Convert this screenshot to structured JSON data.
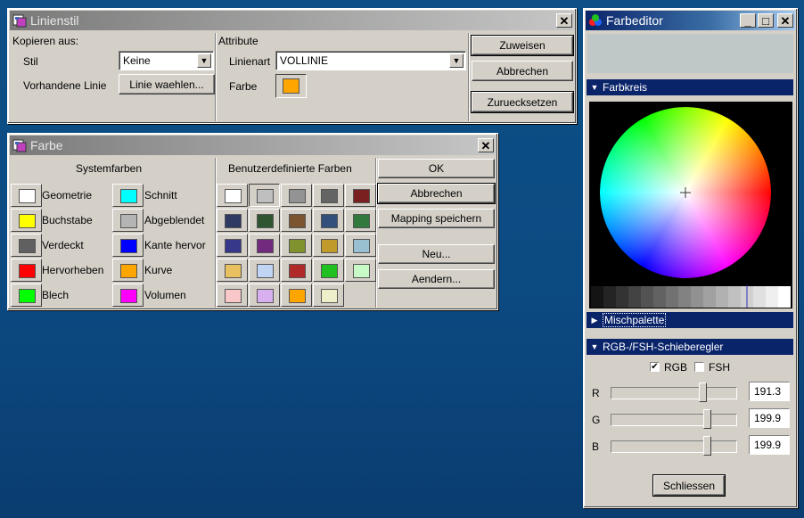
{
  "linienstil": {
    "title": "Linienstil",
    "kopieren_aus": "Kopieren aus:",
    "stil_label": "Stil",
    "stil_value": "Keine",
    "vorhandene_linie_label": "Vorhandene Linie",
    "linie_waehlen": "Linie waehlen...",
    "attribute": "Attribute",
    "linienart_label": "Linienart",
    "linienart_value": "VOLLINIE",
    "farbe_label": "Farbe",
    "farbe_color": "#ffa500",
    "zuweisen": "Zuweisen",
    "abbrechen": "Abbrechen",
    "zuruecksetzen": "Zuruecksetzen"
  },
  "farbe": {
    "title": "Farbe",
    "systemfarben": "Systemfarben",
    "benutzer": "Benutzerdefinierte Farben",
    "system_left": [
      {
        "label": "Geometrie",
        "color": "#ffffff"
      },
      {
        "label": "Buchstabe",
        "color": "#ffff00"
      },
      {
        "label": "Verdeckt",
        "color": "#606060"
      },
      {
        "label": "Hervorheben",
        "color": "#ff0000"
      },
      {
        "label": "Blech",
        "color": "#00ff00"
      }
    ],
    "system_right": [
      {
        "label": "Schnitt",
        "color": "#00ffff"
      },
      {
        "label": "Abgeblendet",
        "color": "#b4b4b4"
      },
      {
        "label": "Kante hervor",
        "color": "#0000ff"
      },
      {
        "label": "Kurve",
        "color": "#ffa500"
      },
      {
        "label": "Volumen",
        "color": "#ff00ff"
      }
    ],
    "custom": [
      [
        "#ffffff",
        "#bfbfbf",
        "#939393",
        "#646464",
        "#7b2020"
      ],
      [
        "#2e3a62",
        "#2f5530",
        "#7a5530",
        "#33507c",
        "#2f7a3c"
      ],
      [
        "#38388a",
        "#722a7e",
        "#7f922e",
        "#c09a2a",
        "#98c0d0"
      ],
      [
        "#e8c060",
        "#c0d4f4",
        "#b02a2a",
        "#20c020",
        "#c8fac8"
      ],
      [
        "#f8c8c8",
        "#d8b0f0",
        "#ffa500",
        "#eeeeca"
      ]
    ],
    "ok": "OK",
    "abbrechen": "Abbrechen",
    "mapping": "Mapping speichern",
    "neu": "Neu...",
    "aendern": "Aendern..."
  },
  "farbeditor": {
    "title": "Farbeditor",
    "farbkreis": "Farbkreis",
    "mischpalette": "Mischpalette",
    "schieberegler": "RGB-/FSH-Schieberegler",
    "rgb_label": "RGB",
    "fsh_label": "FSH",
    "rgb_checked": true,
    "fsh_checked": false,
    "sliders": [
      {
        "label": "R",
        "value": "191.3",
        "level": 0.75
      },
      {
        "label": "G",
        "value": "199.9",
        "level": 0.784
      },
      {
        "label": "B",
        "value": "199.9",
        "level": 0.784
      }
    ],
    "schliessen": "Schliessen",
    "check_glyph": "✔",
    "close_glyph": "✕",
    "min_glyph": "_",
    "max_glyph": "□",
    "combo_glyph": "▼",
    "expanded_glyph": "▼",
    "collapsed_glyph": "▶"
  }
}
